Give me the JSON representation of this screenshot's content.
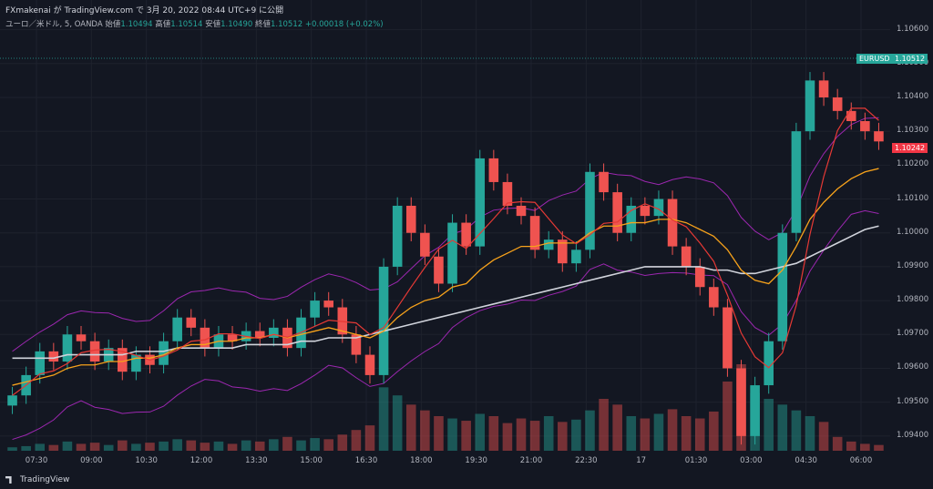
{
  "header": {
    "publisher_line": "FXmakenai が TradingView.com で 3月 20, 2022 08:44 UTC+9 に公開",
    "symbol": "ユーロ／米ドル, 5, OANDA",
    "open_label": "始値",
    "open": "1.10494",
    "high_label": "高値",
    "high": "1.10514",
    "low_label": "安値",
    "low": "1.10490",
    "close_label": "終値",
    "close": "1.10512",
    "change": "+0.00018 (+0.02%)"
  },
  "tags": {
    "symbol_tag": "EURUSD",
    "last_price": "1.10512",
    "bid_price": "1.10242"
  },
  "footer": {
    "brand": "TradingView"
  },
  "colors": {
    "background": "#131722",
    "up": "#26a69a",
    "down": "#ef5350",
    "price_tag": "#26a69a",
    "bid_tag": "#f23645",
    "sma_white": "#d1d4dc",
    "ema_orange": "#f7a21b",
    "ema_red": "#e53935",
    "bollinger": "#9c27b0",
    "rci_green": "#4caf50",
    "blue": "#2962ff"
  },
  "chart_data": {
    "type": "candlestick",
    "y_ticks": [
      "1.10600",
      "1.10500",
      "1.10400",
      "1.10300",
      "1.10200",
      "1.10100",
      "1.10000",
      "1.09900",
      "1.09800",
      "1.09700",
      "1.09600",
      "1.09500",
      "1.09400"
    ],
    "x_ticks": [
      "07:30",
      "09:00",
      "10:30",
      "12:00",
      "13:30",
      "15:00",
      "16:30",
      "18:00",
      "19:30",
      "21:00",
      "22:30",
      "17",
      "01:30",
      "03:00",
      "04:30",
      "06:00"
    ],
    "ylim": [
      1.0937,
      1.1065
    ],
    "series": [
      {
        "name": "close",
        "values": [
          1.0952,
          1.0958,
          1.0965,
          1.0962,
          1.097,
          1.0968,
          1.0962,
          1.0966,
          1.0959,
          1.0964,
          1.0961,
          1.0968,
          1.0975,
          1.0972,
          1.0966,
          1.097,
          1.0968,
          1.0971,
          1.0969,
          1.0972,
          1.0966,
          1.0975,
          1.098,
          1.0978,
          1.097,
          1.0964,
          1.0958,
          1.099,
          1.1008,
          1.1,
          1.0993,
          1.0985,
          1.1003,
          1.0996,
          1.1022,
          1.1015,
          1.1008,
          1.1005,
          1.0995,
          1.0998,
          1.0991,
          1.0995,
          1.1018,
          1.1012,
          1.1,
          1.1008,
          1.1005,
          1.101,
          1.0996,
          1.099,
          1.0984,
          1.0978,
          1.096,
          1.094,
          1.0955,
          1.0968,
          1.1,
          1.103,
          1.1045,
          1.104,
          1.1036,
          1.1033,
          1.103,
          1.1027
        ]
      },
      {
        "name": "SMA",
        "values": [
          1.0963,
          1.0963,
          1.0963,
          1.0963,
          1.0964,
          1.0964,
          1.0964,
          1.0964,
          1.0964,
          1.0965,
          1.0965,
          1.0965,
          1.0966,
          1.0966,
          1.0966,
          1.0966,
          1.0966,
          1.0967,
          1.0967,
          1.0967,
          1.0967,
          1.0968,
          1.0968,
          1.0969,
          1.0969,
          1.0969,
          1.097,
          1.0971,
          1.0972,
          1.0973,
          1.0974,
          1.0975,
          1.0976,
          1.0977,
          1.0978,
          1.0979,
          1.098,
          1.0981,
          1.0982,
          1.0983,
          1.0984,
          1.0985,
          1.0986,
          1.0987,
          1.0988,
          1.0989,
          1.099,
          1.099,
          1.099,
          1.099,
          1.099,
          1.0989,
          1.0989,
          1.0988,
          1.0988,
          1.0989,
          1.099,
          1.0991,
          1.0993,
          1.0995,
          1.0997,
          1.0999,
          1.1001,
          1.1002
        ]
      },
      {
        "name": "EMA",
        "values": [
          1.0955,
          1.0956,
          1.0957,
          1.0958,
          1.096,
          1.0961,
          1.0961,
          1.0962,
          1.0962,
          1.0963,
          1.0963,
          1.0964,
          1.0966,
          1.0967,
          1.0967,
          1.0968,
          1.0968,
          1.0969,
          1.0969,
          1.097,
          1.0969,
          1.097,
          1.0971,
          1.0972,
          1.0971,
          1.097,
          1.0969,
          1.0971,
          1.0975,
          1.0978,
          1.098,
          1.0981,
          1.0984,
          1.0985,
          1.0989,
          1.0992,
          1.0994,
          1.0996,
          1.0996,
          1.0997,
          1.0997,
          1.0997,
          1.1,
          1.1002,
          1.1002,
          1.1003,
          1.1003,
          1.1004,
          1.1004,
          1.1003,
          1.1001,
          1.0999,
          1.0995,
          1.0989,
          1.0986,
          1.0985,
          1.0989,
          1.0996,
          1.1004,
          1.1009,
          1.1013,
          1.1016,
          1.1018,
          1.1019
        ]
      }
    ],
    "volume": [
      3,
      4,
      6,
      5,
      8,
      6,
      7,
      5,
      9,
      6,
      7,
      8,
      10,
      9,
      7,
      8,
      6,
      9,
      8,
      10,
      12,
      9,
      11,
      10,
      14,
      18,
      22,
      55,
      48,
      40,
      35,
      30,
      28,
      26,
      32,
      30,
      24,
      28,
      26,
      30,
      25,
      27,
      35,
      45,
      40,
      30,
      28,
      32,
      36,
      30,
      28,
      34,
      60,
      75,
      50,
      45,
      40,
      35,
      30,
      25,
      12,
      8,
      6,
      5
    ]
  }
}
